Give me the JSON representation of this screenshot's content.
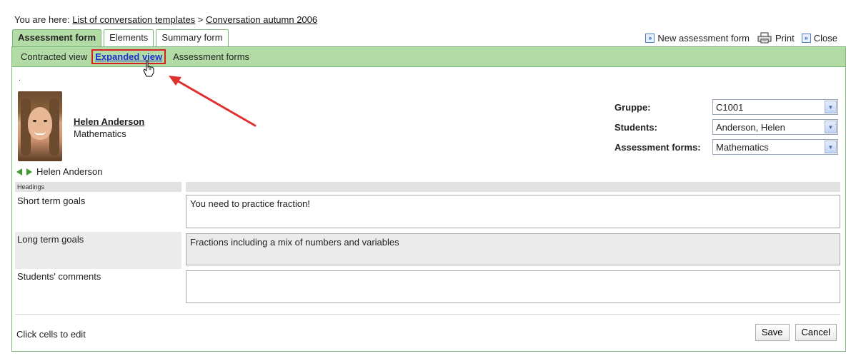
{
  "breadcrumb": {
    "prefix": "You are here: ",
    "link1": "List of conversation templates",
    "sep": " > ",
    "link2": "Conversation autumn 2006"
  },
  "tabs": [
    {
      "label": "Assessment form",
      "active": true
    },
    {
      "label": "Elements",
      "active": false
    },
    {
      "label": "Summary form",
      "active": false
    }
  ],
  "actions": {
    "new_form": "New assessment form",
    "print": "Print",
    "close": "Close"
  },
  "subnav": [
    {
      "label": "Contracted view",
      "selected": false
    },
    {
      "label": "Expanded view",
      "selected": true
    },
    {
      "label": "Assessment forms",
      "selected": false
    }
  ],
  "dot": ".",
  "student": {
    "name": "Helen Anderson",
    "subject": "Mathematics",
    "nav_name": "Helen Anderson"
  },
  "selectors": [
    {
      "label": "Gruppe:",
      "value": "C1001"
    },
    {
      "label": "Students:",
      "value": "Anderson, Helen"
    },
    {
      "label": "Assessment forms:",
      "value": "Mathematics"
    }
  ],
  "headings_label": "Headings",
  "rows": [
    {
      "label": "Short term goals",
      "value": "You need to practice fraction!"
    },
    {
      "label": "Long term goals",
      "value": "Fractions including a mix of numbers and variables"
    },
    {
      "label": "Students' comments",
      "value": ""
    }
  ],
  "footer": {
    "hint": "Click cells to edit",
    "save": "Save",
    "cancel": "Cancel"
  },
  "colors": {
    "accent_green": "#b3dba6",
    "border_green": "#7db77d",
    "highlight_red": "#d42020",
    "link_blue": "#1a2fcf"
  }
}
